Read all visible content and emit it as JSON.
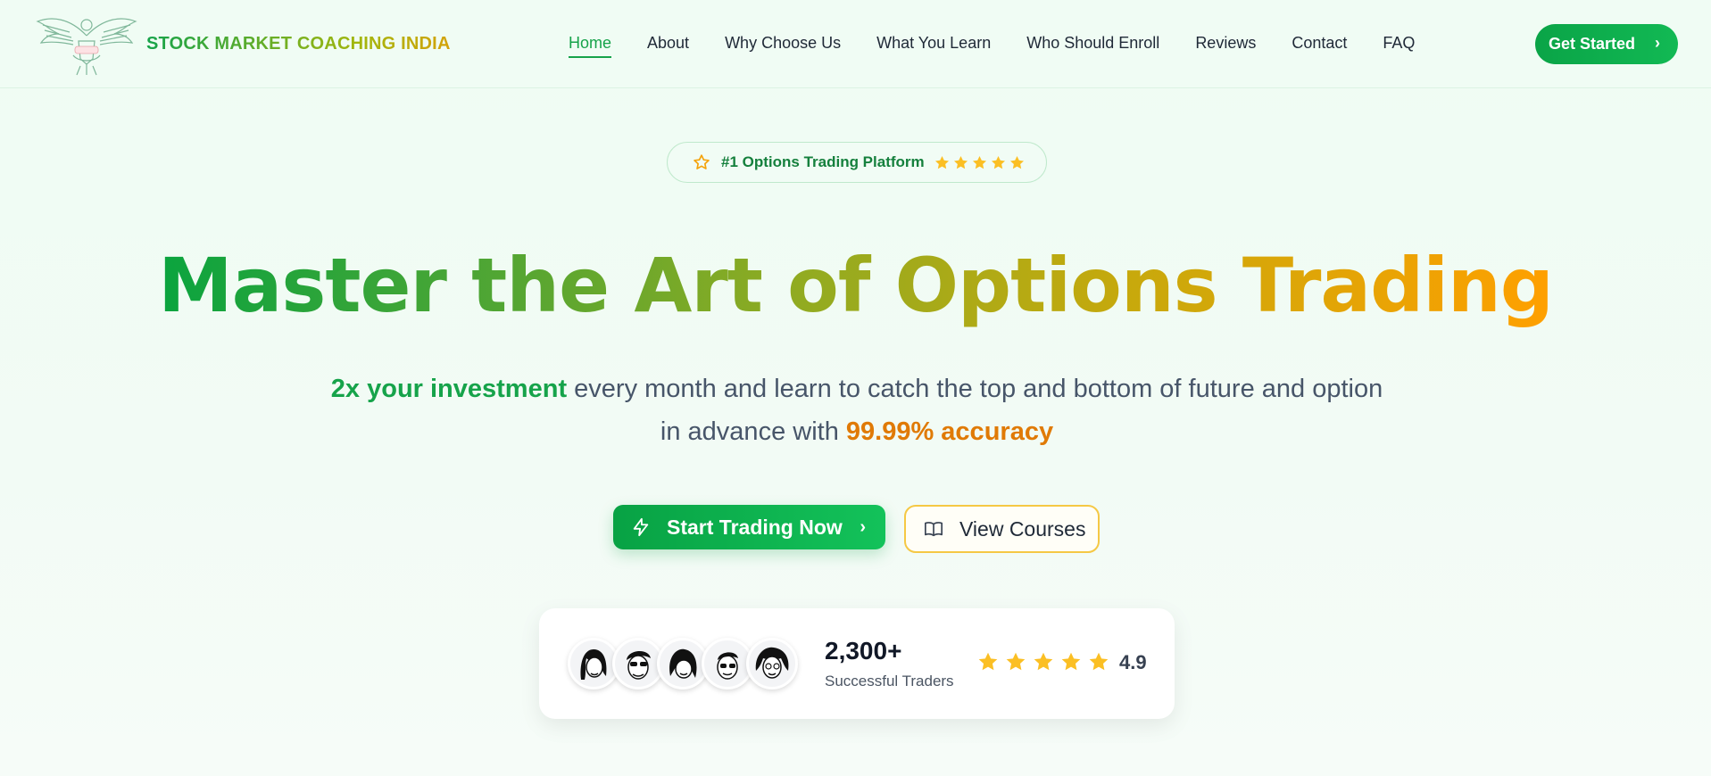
{
  "brand": {
    "name": "STOCK MARKET COACHING INDIA",
    "logo_icon": "eagle-emblem",
    "gradient_start": "#16a34a",
    "gradient_end": "#d4a20a"
  },
  "nav": {
    "items": [
      {
        "label": "Home",
        "active": true
      },
      {
        "label": "About"
      },
      {
        "label": "Why Choose Us"
      },
      {
        "label": "What You Learn"
      },
      {
        "label": "Who Should Enroll"
      },
      {
        "label": "Reviews"
      },
      {
        "label": "Contact"
      },
      {
        "label": "FAQ"
      }
    ],
    "cta_label": "Get Started",
    "cta_icon": "chevron-right-icon"
  },
  "hero": {
    "badge": {
      "icon": "star-outline-icon",
      "text": "#1 Options Trading Platform",
      "stars": 5
    },
    "headline": "Master the Art of Options Trading",
    "subtitle": {
      "highlight_start": "2x your investment",
      "middle": " every month and learn to catch the top and bottom of future and option in advance with ",
      "highlight_end": "99.99% accuracy"
    },
    "primary_cta": {
      "label": "Start Trading Now",
      "icon": "lightning-icon"
    },
    "secondary_cta": {
      "label": "View Courses",
      "icon": "book-open-icon"
    }
  },
  "stats": {
    "avatar_count": 5,
    "count": "2,300+",
    "count_label": "Successful Traders",
    "rating_stars": 5,
    "rating_value": "4.9"
  },
  "colors": {
    "primary_green": "#16a34a",
    "accent_orange": "#e07a06",
    "star_yellow": "#fbbf24",
    "border_yellow": "#f5c845"
  }
}
